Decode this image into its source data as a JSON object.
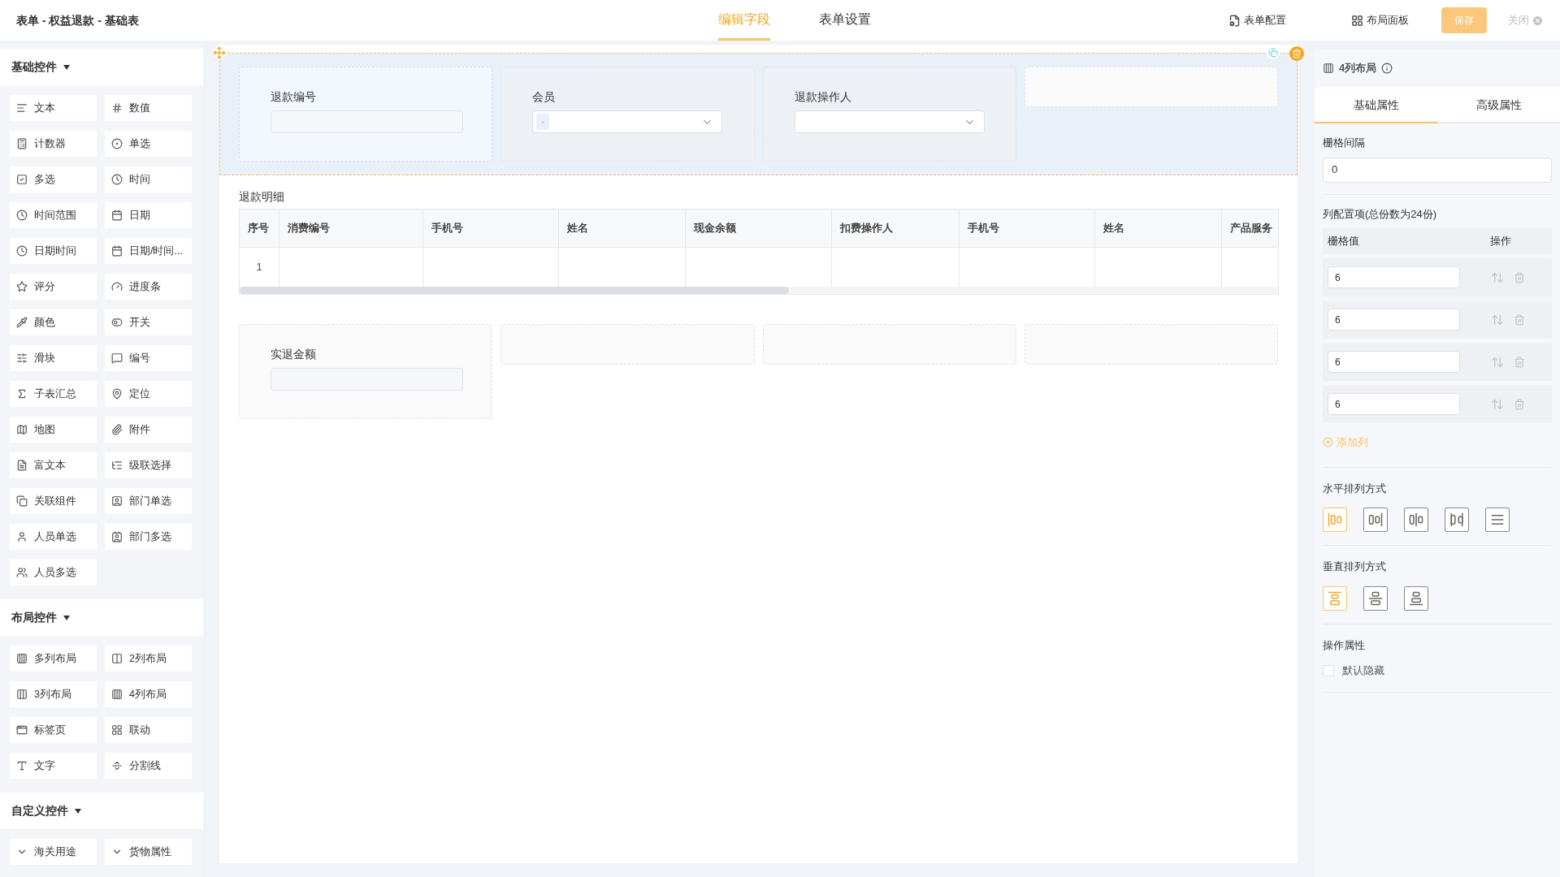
{
  "header": {
    "title": "表单 - 权益退款 - 基础表",
    "tabs": [
      {
        "label": "编辑字段",
        "selected": true
      },
      {
        "label": "表单设置",
        "selected": false
      }
    ],
    "actions": [
      "表单配置",
      "布局面板"
    ],
    "save": "保存",
    "close": "关闭"
  },
  "palette": [
    {
      "title": "基础控件",
      "expanded": true,
      "items": [
        "文本",
        "数值",
        "计数器",
        "单选",
        "多选",
        "时间",
        "时间范围",
        "日期",
        "日期时间",
        "日期/时间...",
        "评分",
        "进度条",
        "颜色",
        "开关",
        "滑块",
        "编号",
        "子表汇总",
        "定位",
        "地图",
        "附件",
        "富文本",
        "级联选择",
        "关联组件",
        "部门单选",
        "人员单选",
        "部门多选",
        "人员多选"
      ]
    },
    {
      "title": "布局控件",
      "expanded": true,
      "items": [
        "多列布局",
        "2列布局",
        "3列布局",
        "4列布局",
        "标签页",
        "联动",
        "文字",
        "分割线"
      ]
    },
    {
      "title": "自定义控件",
      "expanded": true,
      "items": [
        "海关用途",
        "货物属性"
      ]
    }
  ],
  "canvas": {
    "top_row": {
      "selected": true,
      "cells": [
        {
          "kind": "text",
          "label": "退款编号",
          "selected": true
        },
        {
          "kind": "select",
          "label": "会员",
          "tag": "-",
          "selected": false
        },
        {
          "kind": "select",
          "label": "退款操作人",
          "selected": false
        },
        {
          "kind": "empty",
          "selected": false
        }
      ]
    },
    "subtable": {
      "title": "退款明细",
      "columns": [
        "序号",
        "消费编号",
        "手机号",
        "姓名",
        "现金余额",
        "扣费操作人",
        "手机号",
        "姓名",
        "产品服务"
      ],
      "rows": [
        [
          "1"
        ]
      ]
    },
    "bottom_row": {
      "cells": [
        {
          "kind": "text",
          "label": "实退金额"
        },
        {
          "kind": "empty"
        },
        {
          "kind": "empty"
        },
        {
          "kind": "empty"
        }
      ]
    }
  },
  "properties": {
    "title": "4列布局",
    "tabs": [
      {
        "label": "基础属性",
        "selected": true
      },
      {
        "label": "高级属性",
        "selected": false
      }
    ],
    "gutter": {
      "label": "栅格间隔",
      "value": "0"
    },
    "columns": {
      "title": "列配置项(总份数为24份)",
      "headers": [
        "栅格值",
        "操作"
      ],
      "values": [
        "6",
        "6",
        "6",
        "6"
      ],
      "add": "添加列"
    },
    "h_align": {
      "title": "水平排列方式",
      "options": [
        {
          "selected": true
        },
        {
          "selected": false
        },
        {
          "selected": false
        },
        {
          "selected": false
        },
        {
          "selected": false
        }
      ]
    },
    "v_align": {
      "title": "垂直排列方式",
      "options": [
        {
          "selected": true
        },
        {
          "selected": false
        },
        {
          "selected": false
        }
      ]
    },
    "operation": {
      "title": "操作属性",
      "hidden": {
        "label": "默认隐藏",
        "checked": false
      }
    }
  }
}
